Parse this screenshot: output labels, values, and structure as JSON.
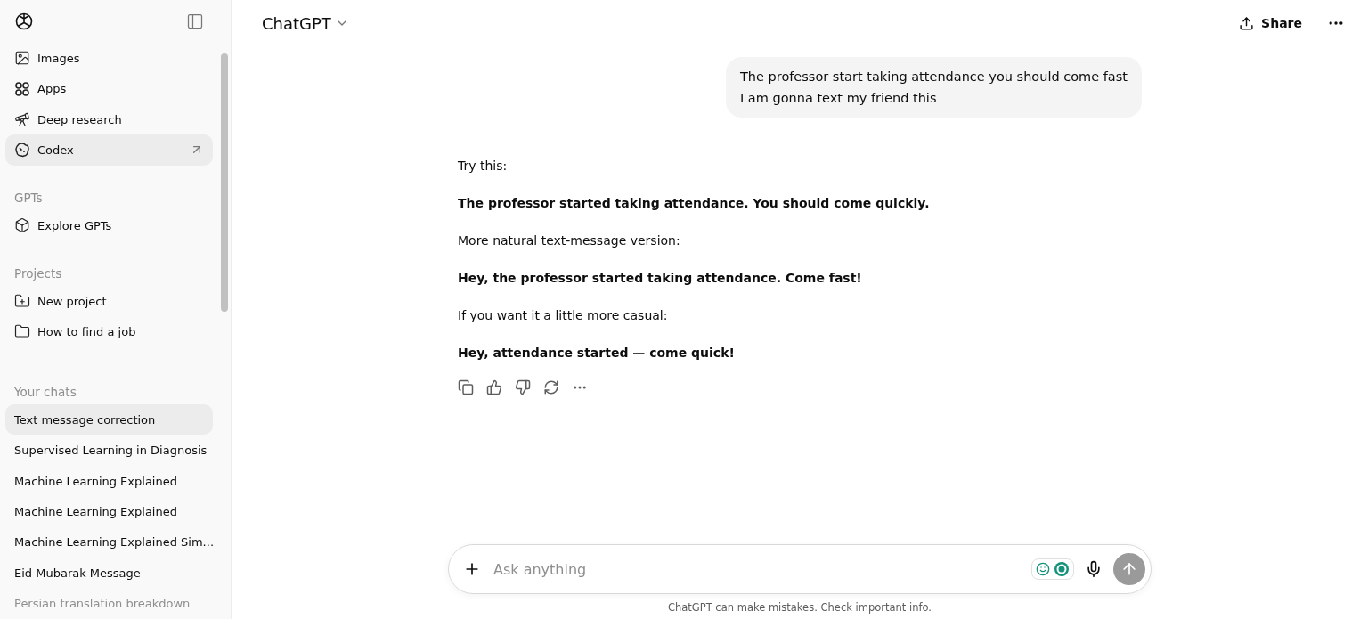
{
  "sidebar": {
    "nav": [
      {
        "kind": "images",
        "label": "Images",
        "selected": false
      },
      {
        "kind": "apps",
        "label": "Apps",
        "selected": false
      },
      {
        "kind": "research",
        "label": "Deep research",
        "selected": false
      },
      {
        "kind": "codex",
        "label": "Codex",
        "selected": true
      }
    ],
    "sections": [
      {
        "title": "GPTs",
        "items": [
          {
            "kind": "explore",
            "label": "Explore GPTs"
          }
        ]
      },
      {
        "title": "Projects",
        "items": [
          {
            "kind": "new-project",
            "label": "New project"
          },
          {
            "kind": "folder",
            "label": "How to find a job"
          }
        ]
      }
    ],
    "chats_title": "Your chats",
    "chats": [
      {
        "label": "Text message correction",
        "selected": true
      },
      {
        "label": "Supervised Learning in Diagnosis",
        "selected": false
      },
      {
        "label": "Machine Learning Explained",
        "selected": false
      },
      {
        "label": "Machine Learning Explained",
        "selected": false
      },
      {
        "label": "Machine Learning Explained Sim...",
        "selected": false
      },
      {
        "label": "Eid Mubarak Message",
        "selected": false
      },
      {
        "label": "Persian translation breakdown",
        "selected": false
      }
    ]
  },
  "header": {
    "model": "ChatGPT",
    "share": "Share"
  },
  "conversation": {
    "user_lines": [
      "The professor start taking attendance you should come fast",
      "I am gonna text my friend this"
    ],
    "reply": [
      {
        "kind": "plain",
        "text": "Try this:"
      },
      {
        "kind": "bold",
        "text": "The professor started taking attendance. You should come quickly."
      },
      {
        "kind": "plain",
        "text": "More natural text-message version:"
      },
      {
        "kind": "bold",
        "text": "Hey, the professor started taking attendance. Come fast!"
      },
      {
        "kind": "plain",
        "text": "If you want it a little more casual:"
      },
      {
        "kind": "bold",
        "text": "Hey, attendance started — come quick!"
      }
    ]
  },
  "composer": {
    "placeholder": "Ask anything"
  },
  "footer": "ChatGPT can make mistakes. Check important info."
}
